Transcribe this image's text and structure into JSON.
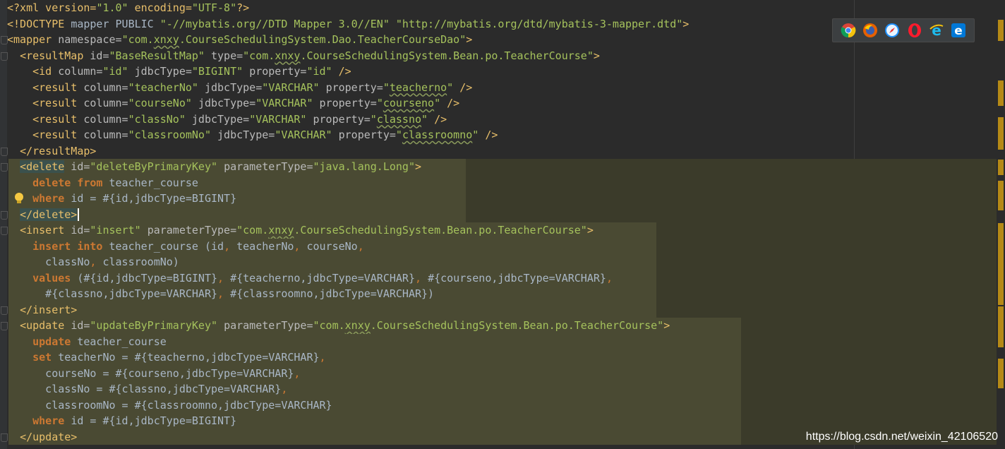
{
  "editor": {
    "lines": [
      {
        "highlight": false,
        "tokens": [
          [
            "pi",
            "<?xml version="
          ],
          [
            "val",
            "\"1.0\""
          ],
          [
            "pi",
            " encoding="
          ],
          [
            "val",
            "\"UTF-8\""
          ],
          [
            "pi",
            "?>"
          ]
        ]
      },
      {
        "highlight": false,
        "tokens": [
          [
            "tag",
            "<!DOCTYPE "
          ],
          [
            "txt",
            "mapper PUBLIC "
          ],
          [
            "val",
            "\"-//mybatis.org//DTD Mapper 3.0//EN\" \"http://mybatis.org/dtd/mybatis-3-mapper.dtd\""
          ],
          [
            "tag",
            ">"
          ]
        ]
      },
      {
        "highlight": false,
        "tokens": [
          [
            "tag",
            "<mapper "
          ],
          [
            "attr",
            "namespace="
          ],
          [
            "val",
            "\"com."
          ],
          [
            "valsq",
            "xnxy"
          ],
          [
            "val",
            ".CourseSchedulingSystem.Dao.TeacherCourseDao\""
          ],
          [
            "tag",
            ">"
          ]
        ]
      },
      {
        "highlight": false,
        "tokens": [
          [
            "txt",
            "  "
          ],
          [
            "tag",
            "<resultMap "
          ],
          [
            "attr",
            "id="
          ],
          [
            "val",
            "\"BaseResultMap\" "
          ],
          [
            "attr",
            "type="
          ],
          [
            "val",
            "\"com."
          ],
          [
            "valsq",
            "xnxy"
          ],
          [
            "val",
            ".CourseSchedulingSystem.Bean.po.TeacherCourse\""
          ],
          [
            "tag",
            ">"
          ]
        ]
      },
      {
        "highlight": false,
        "tokens": [
          [
            "txt",
            "    "
          ],
          [
            "tag",
            "<id "
          ],
          [
            "attr",
            "column="
          ],
          [
            "val",
            "\"id\" "
          ],
          [
            "attr",
            "jdbcType="
          ],
          [
            "val",
            "\"BIGINT\" "
          ],
          [
            "attr",
            "property="
          ],
          [
            "val",
            "\"id\" "
          ],
          [
            "tag",
            "/>"
          ]
        ]
      },
      {
        "highlight": false,
        "tokens": [
          [
            "txt",
            "    "
          ],
          [
            "tag",
            "<result "
          ],
          [
            "attr",
            "column="
          ],
          [
            "val",
            "\"teacherNo\" "
          ],
          [
            "attr",
            "jdbcType="
          ],
          [
            "val",
            "\"VARCHAR\" "
          ],
          [
            "attr",
            "property="
          ],
          [
            "val",
            "\""
          ],
          [
            "valsq",
            "teacherno"
          ],
          [
            "val",
            "\" "
          ],
          [
            "tag",
            "/>"
          ]
        ]
      },
      {
        "highlight": false,
        "tokens": [
          [
            "txt",
            "    "
          ],
          [
            "tag",
            "<result "
          ],
          [
            "attr",
            "column="
          ],
          [
            "val",
            "\"courseNo\" "
          ],
          [
            "attr",
            "jdbcType="
          ],
          [
            "val",
            "\"VARCHAR\" "
          ],
          [
            "attr",
            "property="
          ],
          [
            "val",
            "\""
          ],
          [
            "valsq",
            "courseno"
          ],
          [
            "val",
            "\" "
          ],
          [
            "tag",
            "/>"
          ]
        ]
      },
      {
        "highlight": false,
        "tokens": [
          [
            "txt",
            "    "
          ],
          [
            "tag",
            "<result "
          ],
          [
            "attr",
            "column="
          ],
          [
            "val",
            "\"classNo\" "
          ],
          [
            "attr",
            "jdbcType="
          ],
          [
            "val",
            "\"VARCHAR\" "
          ],
          [
            "attr",
            "property="
          ],
          [
            "val",
            "\""
          ],
          [
            "valsq",
            "classno"
          ],
          [
            "val",
            "\" "
          ],
          [
            "tag",
            "/>"
          ]
        ]
      },
      {
        "highlight": false,
        "tokens": [
          [
            "txt",
            "    "
          ],
          [
            "tag",
            "<result "
          ],
          [
            "attr",
            "column="
          ],
          [
            "val",
            "\"classroomNo\" "
          ],
          [
            "attr",
            "jdbcType="
          ],
          [
            "val",
            "\"VARCHAR\" "
          ],
          [
            "attr",
            "property="
          ],
          [
            "val",
            "\""
          ],
          [
            "valsq",
            "classroomno"
          ],
          [
            "val",
            "\" "
          ],
          [
            "tag",
            "/>"
          ]
        ]
      },
      {
        "highlight": false,
        "tokens": [
          [
            "txt",
            "  "
          ],
          [
            "tag",
            "</resultMap>"
          ]
        ]
      },
      {
        "highlight": true,
        "tokens": [
          [
            "txt",
            "  "
          ],
          [
            "taghl",
            "<delete"
          ],
          [
            "attr",
            " id="
          ],
          [
            "val",
            "\"deleteByPrimaryKey\" "
          ],
          [
            "attr",
            "parameterType="
          ],
          [
            "val",
            "\"java.lang.Long\""
          ],
          [
            "tag",
            ">"
          ]
        ]
      },
      {
        "highlight": true,
        "tokens": [
          [
            "txt",
            "    "
          ],
          [
            "kw",
            "delete from "
          ],
          [
            "txt",
            "teacher_course"
          ]
        ]
      },
      {
        "highlight": true,
        "tokens": [
          [
            "txt",
            "    "
          ],
          [
            "kw",
            "where "
          ],
          [
            "txt",
            "id = #{id,jdbcType=BIGINT}"
          ]
        ]
      },
      {
        "highlight": true,
        "caret": true,
        "tokens": [
          [
            "txt",
            "  "
          ],
          [
            "taghl",
            "</delete>"
          ]
        ]
      },
      {
        "highlight": true,
        "tokens": [
          [
            "txt",
            "  "
          ],
          [
            "tag",
            "<insert "
          ],
          [
            "attr",
            "id="
          ],
          [
            "val",
            "\"insert\" "
          ],
          [
            "attr",
            "parameterType="
          ],
          [
            "val",
            "\"com."
          ],
          [
            "valsq",
            "xnxy"
          ],
          [
            "val",
            ".CourseSchedulingSystem.Bean.po.TeacherCourse\""
          ],
          [
            "tag",
            ">"
          ]
        ]
      },
      {
        "highlight": true,
        "tokens": [
          [
            "txt",
            "    "
          ],
          [
            "kw",
            "insert into "
          ],
          [
            "txt",
            "teacher_course (id"
          ],
          [
            "punct",
            ", "
          ],
          [
            "txt",
            "teacherNo"
          ],
          [
            "punct",
            ", "
          ],
          [
            "txt",
            "courseNo"
          ],
          [
            "punct",
            ","
          ]
        ]
      },
      {
        "highlight": true,
        "tokens": [
          [
            "txt",
            "      classNo"
          ],
          [
            "punct",
            ", "
          ],
          [
            "txt",
            "classroomNo)"
          ]
        ]
      },
      {
        "highlight": true,
        "tokens": [
          [
            "txt",
            "    "
          ],
          [
            "kw",
            "values "
          ],
          [
            "txt",
            "(#{id,jdbcType=BIGINT}"
          ],
          [
            "punct",
            ", "
          ],
          [
            "txt",
            "#{teacherno,jdbcType=VARCHAR}"
          ],
          [
            "punct",
            ", "
          ],
          [
            "txt",
            "#{courseno,jdbcType=VARCHAR}"
          ],
          [
            "punct",
            ","
          ]
        ]
      },
      {
        "highlight": true,
        "tokens": [
          [
            "txt",
            "      #{classno,jdbcType=VARCHAR}"
          ],
          [
            "punct",
            ", "
          ],
          [
            "txt",
            "#{classroomno,jdbcType=VARCHAR})"
          ]
        ]
      },
      {
        "highlight": true,
        "tokens": [
          [
            "txt",
            "  "
          ],
          [
            "tag",
            "</insert>"
          ]
        ]
      },
      {
        "highlight": true,
        "tokens": [
          [
            "txt",
            "  "
          ],
          [
            "tag",
            "<update "
          ],
          [
            "attr",
            "id="
          ],
          [
            "val",
            "\"updateByPrimaryKey\" "
          ],
          [
            "attr",
            "parameterType="
          ],
          [
            "val",
            "\"com."
          ],
          [
            "valsq",
            "xnxy"
          ],
          [
            "val",
            ".CourseSchedulingSystem.Bean.po.TeacherCourse\""
          ],
          [
            "tag",
            ">"
          ]
        ]
      },
      {
        "highlight": true,
        "tokens": [
          [
            "txt",
            "    "
          ],
          [
            "kw",
            "update "
          ],
          [
            "txt",
            "teacher_course"
          ]
        ]
      },
      {
        "highlight": true,
        "tokens": [
          [
            "txt",
            "    "
          ],
          [
            "kw",
            "set "
          ],
          [
            "txt",
            "teacherNo = #{teacherno,jdbcType=VARCHAR}"
          ],
          [
            "punct",
            ","
          ]
        ]
      },
      {
        "highlight": true,
        "tokens": [
          [
            "txt",
            "      courseNo = #{courseno,jdbcType=VARCHAR}"
          ],
          [
            "punct",
            ","
          ]
        ]
      },
      {
        "highlight": true,
        "tokens": [
          [
            "txt",
            "      classNo = #{classno,jdbcType=VARCHAR}"
          ],
          [
            "punct",
            ","
          ]
        ]
      },
      {
        "highlight": true,
        "tokens": [
          [
            "txt",
            "      classroomNo = #{classroomno,jdbcType=VARCHAR}"
          ]
        ]
      },
      {
        "highlight": true,
        "tokens": [
          [
            "txt",
            "    "
          ],
          [
            "kw",
            "where "
          ],
          [
            "txt",
            "id = #{id,jdbcType=BIGINT}"
          ]
        ]
      },
      {
        "highlight": true,
        "tokens": [
          [
            "txt",
            "  "
          ],
          [
            "tag",
            "</update>"
          ]
        ]
      }
    ]
  },
  "browser_icons": [
    "chrome-icon",
    "firefox-icon",
    "safari-icon",
    "opera-icon",
    "ie-icon",
    "edge-icon"
  ],
  "watermark": "https://blog.csdn.net/weixin_42106520",
  "colors": {
    "background": "#2b2b2b",
    "highlight": "#3a3a2a",
    "tag": "#e8bf6a",
    "value": "#a5c25c",
    "keyword": "#cc7832",
    "text": "#a9b7c6",
    "scroll_mark": "#b58a16"
  }
}
